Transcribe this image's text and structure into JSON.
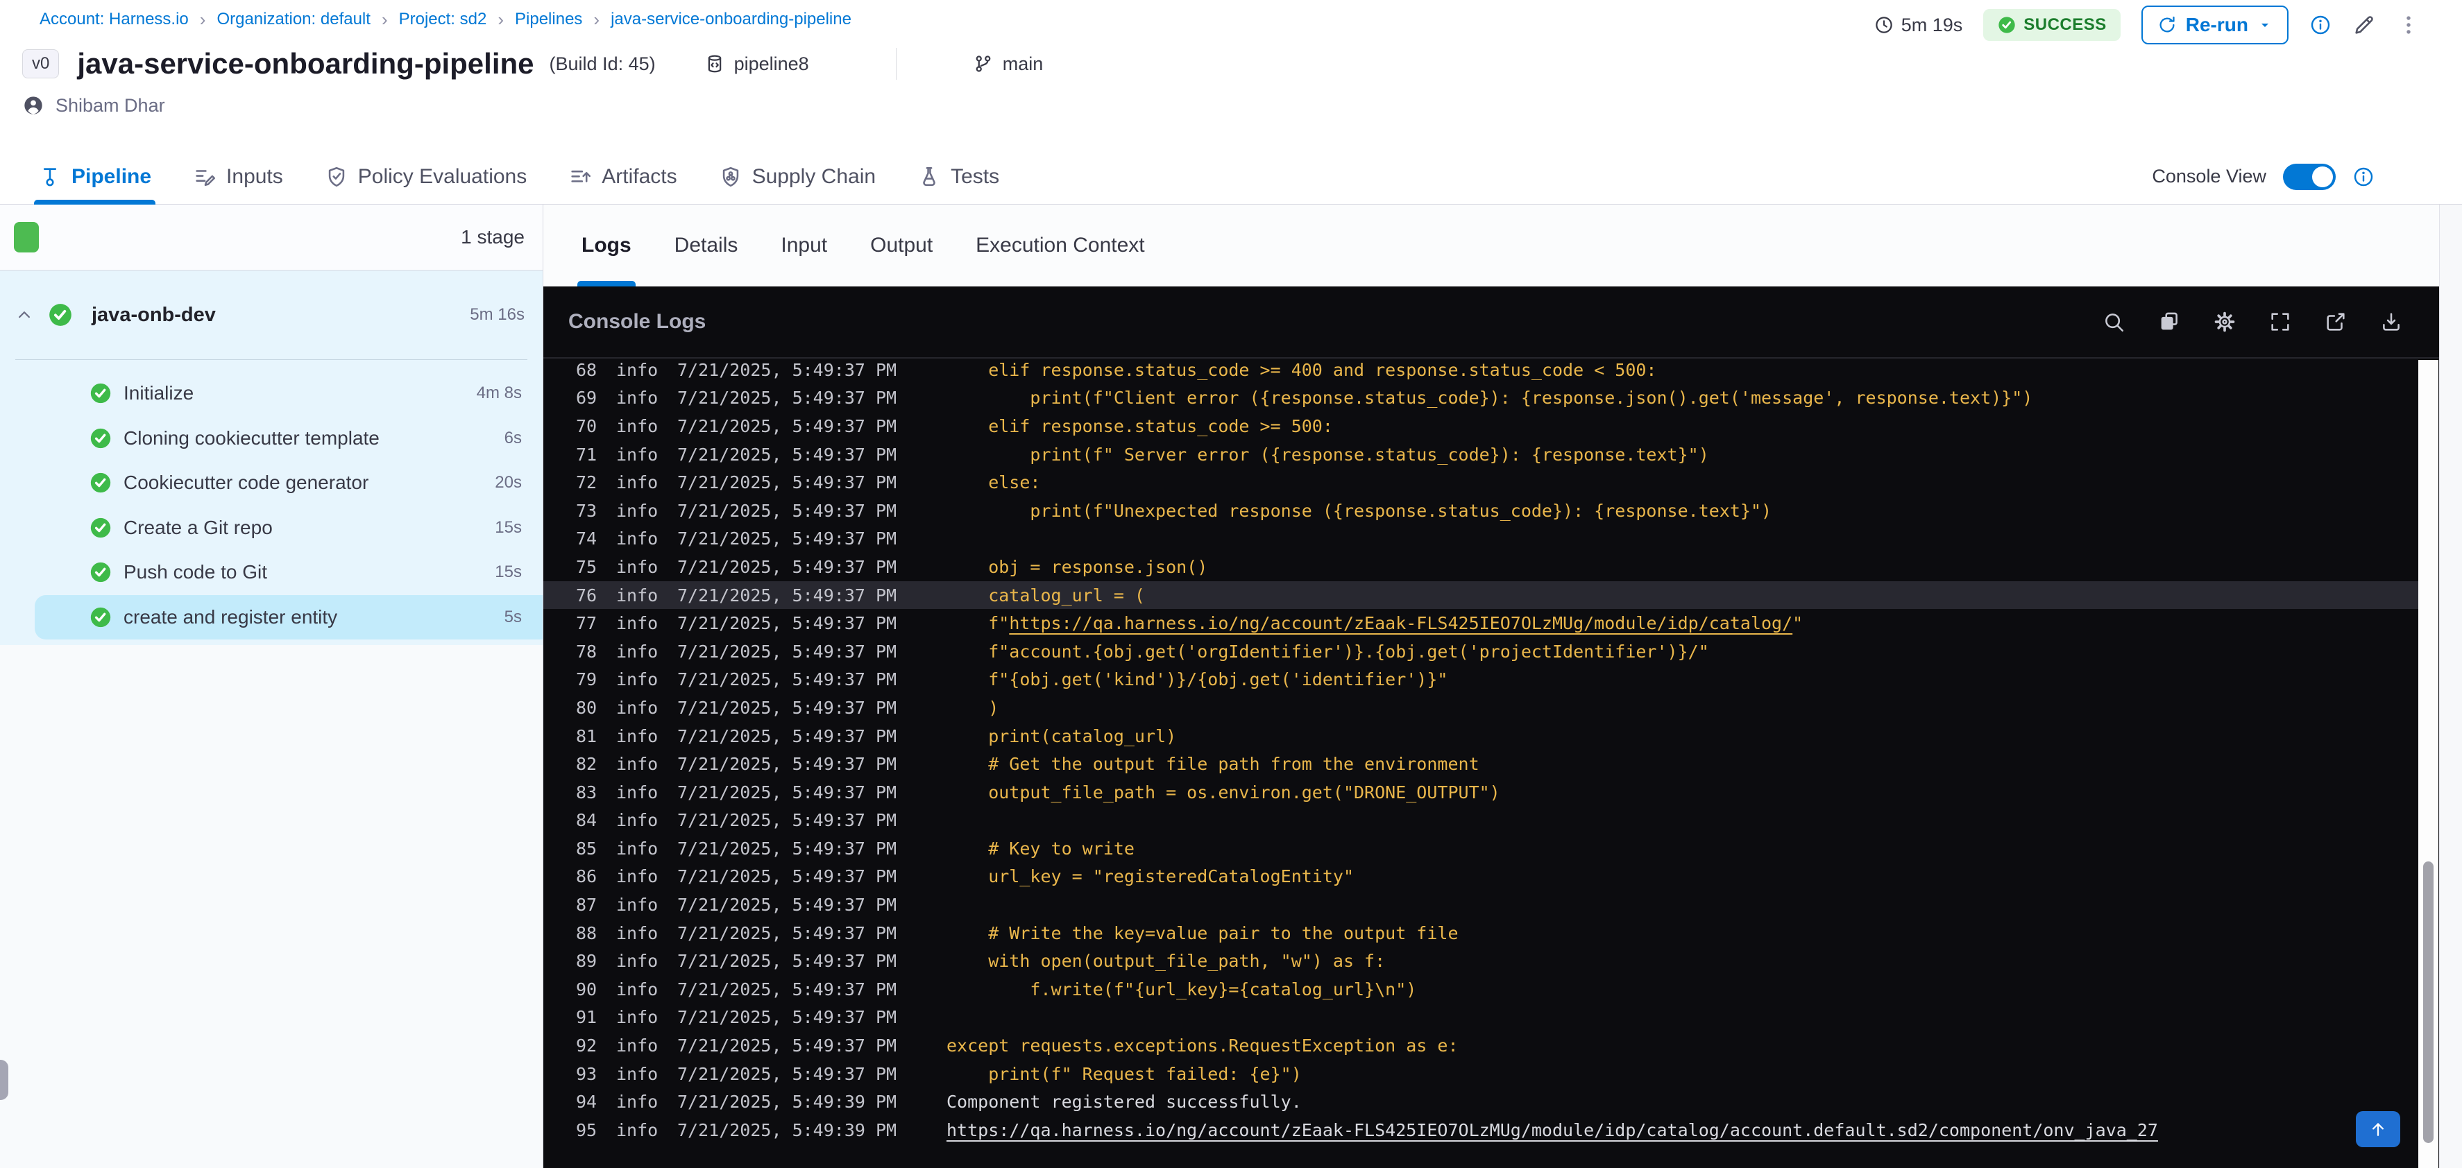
{
  "breadcrumb": {
    "items": [
      "Account: Harness.io",
      "Organization: default",
      "Project: sd2",
      "Pipelines",
      "java-service-onboarding-pipeline"
    ]
  },
  "header": {
    "version_badge": "v0",
    "title": "java-service-onboarding-pipeline",
    "build_id": "(Build Id: 45)",
    "repo_name": "pipeline8",
    "branch": "main",
    "author": "Shibam Dhar",
    "duration": "5m 19s",
    "status": "SUCCESS",
    "rerun_label": "Re-run"
  },
  "tabs": [
    {
      "label": "Pipeline",
      "icon": "pipeline-icon",
      "active": true
    },
    {
      "label": "Inputs",
      "icon": "inputs-icon",
      "active": false
    },
    {
      "label": "Policy Evaluations",
      "icon": "policy-icon",
      "active": false
    },
    {
      "label": "Artifacts",
      "icon": "artifacts-icon",
      "active": false
    },
    {
      "label": "Supply Chain",
      "icon": "supply-chain-icon",
      "active": false
    },
    {
      "label": "Tests",
      "icon": "tests-icon",
      "active": false
    }
  ],
  "console_view": {
    "label": "Console View",
    "enabled": true
  },
  "sidebar": {
    "stage_count": "1 stage",
    "stage": {
      "name": "java-onb-dev",
      "duration": "5m 16s"
    },
    "steps": [
      {
        "label": "Initialize",
        "duration": "4m 8s",
        "selected": false
      },
      {
        "label": "Cloning cookiecutter template",
        "duration": "6s",
        "selected": false
      },
      {
        "label": "Cookiecutter code generator",
        "duration": "20s",
        "selected": false
      },
      {
        "label": "Create a Git repo",
        "duration": "15s",
        "selected": false
      },
      {
        "label": "Push code to Git",
        "duration": "15s",
        "selected": false
      },
      {
        "label": "create and register entity",
        "duration": "5s",
        "selected": true
      }
    ]
  },
  "panel": {
    "tabs": [
      {
        "label": "Logs",
        "active": true
      },
      {
        "label": "Details",
        "active": false
      },
      {
        "label": "Input",
        "active": false
      },
      {
        "label": "Output",
        "active": false
      },
      {
        "label": "Execution Context",
        "active": false
      }
    ],
    "console_title": "Console Logs",
    "toolbar_icons": [
      "search-icon",
      "copy-icon",
      "settings-icon",
      "fullscreen-icon",
      "open-in-new-icon",
      "download-icon"
    ]
  },
  "colors": {
    "accent": "#0278d5",
    "success_green": "#3eba49",
    "log_yellow": "#e9b64b",
    "console_bg": "#0c0c0f"
  },
  "logs": {
    "rows": [
      {
        "n": 68,
        "lvl": "info",
        "ts": "7/21/2025, 5:49:37 PM",
        "segs": [
          {
            "t": "    elif response.status_code >= 400 and response.status_code < 500:"
          }
        ]
      },
      {
        "n": 69,
        "lvl": "info",
        "ts": "7/21/2025, 5:49:37 PM",
        "segs": [
          {
            "t": "        print(f\"Client error ({response.status_code}): {response.json().get('message', response.text)}\")"
          }
        ]
      },
      {
        "n": 70,
        "lvl": "info",
        "ts": "7/21/2025, 5:49:37 PM",
        "segs": [
          {
            "t": "    elif response.status_code >= 500:"
          }
        ]
      },
      {
        "n": 71,
        "lvl": "info",
        "ts": "7/21/2025, 5:49:37 PM",
        "segs": [
          {
            "t": "        print(f\" Server error ({response.status_code}): {response.text}\")"
          }
        ]
      },
      {
        "n": 72,
        "lvl": "info",
        "ts": "7/21/2025, 5:49:37 PM",
        "segs": [
          {
            "t": "    else:"
          }
        ]
      },
      {
        "n": 73,
        "lvl": "info",
        "ts": "7/21/2025, 5:49:37 PM",
        "segs": [
          {
            "t": "        print(f\"Unexpected response ({response.status_code}): {response.text}\")"
          }
        ]
      },
      {
        "n": 74,
        "lvl": "info",
        "ts": "7/21/2025, 5:49:37 PM",
        "segs": []
      },
      {
        "n": 75,
        "lvl": "info",
        "ts": "7/21/2025, 5:49:37 PM",
        "segs": [
          {
            "t": "    obj = response.json()"
          }
        ]
      },
      {
        "n": 76,
        "lvl": "info",
        "ts": "7/21/2025, 5:49:37 PM",
        "hl": true,
        "segs": [
          {
            "t": "    catalog_url = ("
          }
        ]
      },
      {
        "n": 77,
        "lvl": "info",
        "ts": "7/21/2025, 5:49:37 PM",
        "segs": [
          {
            "t": "    f\""
          },
          {
            "t": "https://qa.harness.io/ng/account/zEaak-FLS425IEO7OLzMUg/module/idp/catalog/",
            "u": true
          },
          {
            "t": "\""
          }
        ]
      },
      {
        "n": 78,
        "lvl": "info",
        "ts": "7/21/2025, 5:49:37 PM",
        "segs": [
          {
            "t": "    f\"account.{obj.get('orgIdentifier')}.{obj.get('projectIdentifier')}/\""
          }
        ]
      },
      {
        "n": 79,
        "lvl": "info",
        "ts": "7/21/2025, 5:49:37 PM",
        "segs": [
          {
            "t": "    f\"{obj.get('kind')}/{obj.get('identifier')}\""
          }
        ]
      },
      {
        "n": 80,
        "lvl": "info",
        "ts": "7/21/2025, 5:49:37 PM",
        "segs": [
          {
            "t": "    )"
          }
        ]
      },
      {
        "n": 81,
        "lvl": "info",
        "ts": "7/21/2025, 5:49:37 PM",
        "segs": [
          {
            "t": "    print(catalog_url)"
          }
        ]
      },
      {
        "n": 82,
        "lvl": "info",
        "ts": "7/21/2025, 5:49:37 PM",
        "segs": [
          {
            "t": "    # Get the output file path from the environment"
          }
        ]
      },
      {
        "n": 83,
        "lvl": "info",
        "ts": "7/21/2025, 5:49:37 PM",
        "segs": [
          {
            "t": "    output_file_path = os.environ.get(\"DRONE_OUTPUT\")"
          }
        ]
      },
      {
        "n": 84,
        "lvl": "info",
        "ts": "7/21/2025, 5:49:37 PM",
        "segs": []
      },
      {
        "n": 85,
        "lvl": "info",
        "ts": "7/21/2025, 5:49:37 PM",
        "segs": [
          {
            "t": "    # Key to write"
          }
        ]
      },
      {
        "n": 86,
        "lvl": "info",
        "ts": "7/21/2025, 5:49:37 PM",
        "segs": [
          {
            "t": "    url_key = \"registeredCatalogEntity\""
          }
        ]
      },
      {
        "n": 87,
        "lvl": "info",
        "ts": "7/21/2025, 5:49:37 PM",
        "segs": []
      },
      {
        "n": 88,
        "lvl": "info",
        "ts": "7/21/2025, 5:49:37 PM",
        "segs": [
          {
            "t": "    # Write the key=value pair to the output file"
          }
        ]
      },
      {
        "n": 89,
        "lvl": "info",
        "ts": "7/21/2025, 5:49:37 PM",
        "segs": [
          {
            "t": "    with open(output_file_path, \"w\") as f:"
          }
        ]
      },
      {
        "n": 90,
        "lvl": "info",
        "ts": "7/21/2025, 5:49:37 PM",
        "segs": [
          {
            "t": "        f.write(f\"{url_key}={catalog_url}\\n\")"
          }
        ]
      },
      {
        "n": 91,
        "lvl": "info",
        "ts": "7/21/2025, 5:49:37 PM",
        "segs": []
      },
      {
        "n": 92,
        "lvl": "info",
        "ts": "7/21/2025, 5:49:37 PM",
        "segs": [
          {
            "t": "except requests.exceptions.RequestException as e:"
          }
        ]
      },
      {
        "n": 93,
        "lvl": "info",
        "ts": "7/21/2025, 5:49:37 PM",
        "segs": [
          {
            "t": "    print(f\" Request failed: {e}\")"
          }
        ]
      },
      {
        "n": 94,
        "lvl": "info",
        "ts": "7/21/2025, 5:49:39 PM",
        "segs": [
          {
            "t": "Component registered successfully.",
            "w": true
          }
        ]
      },
      {
        "n": 95,
        "lvl": "info",
        "ts": "7/21/2025, 5:49:39 PM",
        "segs": [
          {
            "t": "https://qa.harness.io/ng/account/zEaak-FLS425IEO7OLzMUg/module/idp/catalog/account.default.sd2/component/onv_java_27",
            "w": true,
            "u": true
          }
        ]
      }
    ]
  }
}
